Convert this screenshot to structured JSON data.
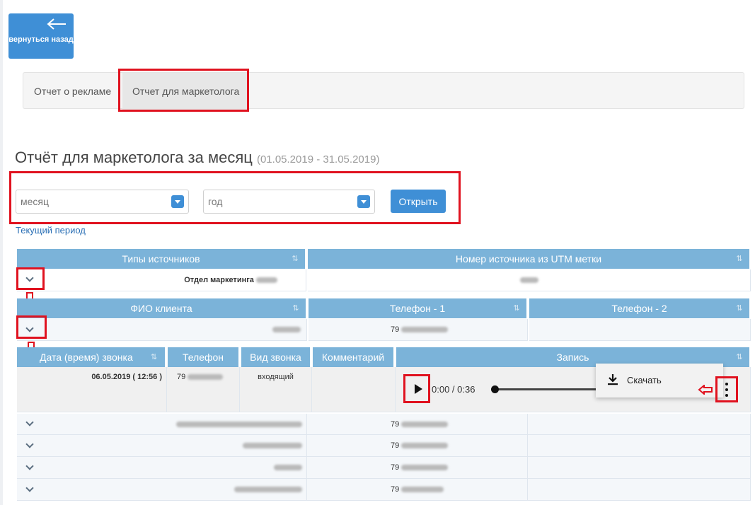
{
  "back_button": {
    "label": "вернуться назад"
  },
  "tabs": [
    {
      "label": "Отчет о рекламе"
    },
    {
      "label": "Отчет для маркетолога"
    }
  ],
  "page_title": {
    "title": "Отчёт для маркетолога за месяц",
    "period": "(01.05.2019 - 31.05.2019)"
  },
  "filters": {
    "month_placeholder": "месяц",
    "year_placeholder": "год",
    "open_label": "Открыть",
    "current_period_link": "Текущий период"
  },
  "sources_table": {
    "headers": [
      "Типы источников",
      "Номер источника из UTM метки"
    ],
    "row": {
      "source_type": "Отдел маркетинга"
    }
  },
  "clients_table": {
    "headers": [
      "ФИО клиента",
      "Телефон - 1",
      "Телефон - 2"
    ],
    "phone_prefix": "79"
  },
  "calls_table": {
    "headers": [
      "Дата (время) звонка",
      "Телефон",
      "Вид звонка",
      "Комментарий",
      "Запись"
    ],
    "row": {
      "datetime": "06.05.2019 ( 12:56 )",
      "phone_prefix": "79",
      "call_type": "входящий",
      "audio_time": "0:00 / 0:36",
      "download_label": "Скачать"
    }
  },
  "more_rows": [
    {
      "phone_prefix": "79"
    },
    {
      "phone_prefix": "79"
    },
    {
      "phone_prefix": "79"
    },
    {
      "phone_prefix": "79"
    }
  ],
  "colors": {
    "accent": "#3f8fd6",
    "header": "#7bb3d9",
    "highlight": "#e0121f"
  }
}
